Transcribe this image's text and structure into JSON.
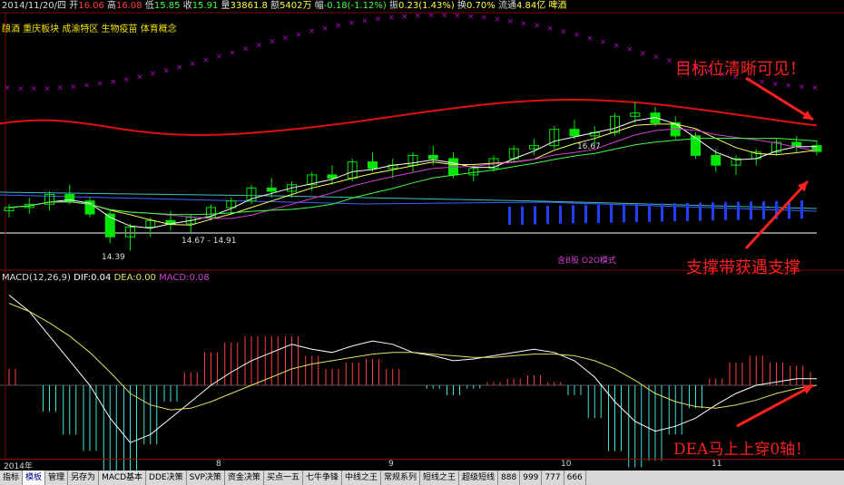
{
  "header": {
    "date": "2014/11/20/四",
    "open_label": "开",
    "open": "16.06",
    "high_label": "高",
    "high": "16.08",
    "low_label": "低",
    "low": "15.85",
    "close_label": "收",
    "close": "15.91",
    "volume_label": "量",
    "volume": "33861.8",
    "amount_label": "额",
    "amount": "5402万",
    "change_label": "幅",
    "change": "-0.18(-1.12%)",
    "amplitude_label": "振",
    "amplitude": "0.23(1.43%)",
    "turnover_label": "换",
    "turnover": "0.70%",
    "float_label": "流通",
    "float_value": "4.84亿",
    "stock_name": "啤酒"
  },
  "concepts": "酿酒 重庆板块 成渝特区 生物疫苗 体育概念",
  "price_labels": {
    "high": "16.67",
    "low": "14.39",
    "mid": "14.67 - 14.91",
    "pattern": "含B股 O2O模式"
  },
  "annotations": {
    "target": "目标位清晰可见！",
    "support": "支撑带获遇支撑",
    "dea": "DEA马上上穿0轴！"
  },
  "macd": {
    "title": "MACD(12,26,9)",
    "dif_label": "DIF:",
    "dif": "0.04",
    "dea_label": "DEA:",
    "dea": "0.00",
    "macd_label": "MACD:",
    "macd": "0.08"
  },
  "dates": [
    "2014年",
    "8",
    "9",
    "10",
    "11"
  ],
  "bottom_tabs": [
    "指标",
    "模板",
    "管理",
    "另存为",
    "MACD基本",
    "DDE决策",
    "SVP决策",
    "资金决策",
    "买点一五",
    "七牛争锋",
    "中线之王",
    "常规系列",
    "短线之王",
    "超级短线",
    "888",
    "999",
    "777",
    "666"
  ],
  "active_tab": "模板",
  "colors": {
    "up": "#00e600",
    "down": "#00e600",
    "red_line": "#e01010",
    "x_marks": "#b000c0",
    "dif": "#ffffff",
    "dea": "#e0e060",
    "macd_pos": "#ff4040",
    "macd_neg": "#40e0e0",
    "annotation": "#ff2020"
  },
  "chart_data": {
    "type": "candlestick",
    "note_series": "price candles trending from ~15 up to 16.67 then consolidating",
    "price_ylim": [
      14.2,
      17.4
    ],
    "candles": [
      [
        15.0,
        15.1,
        14.9,
        15.05
      ],
      [
        15.05,
        15.2,
        14.95,
        15.1
      ],
      [
        15.1,
        15.3,
        15.0,
        15.25
      ],
      [
        15.25,
        15.4,
        15.1,
        15.15
      ],
      [
        15.15,
        15.2,
        14.9,
        14.95
      ],
      [
        14.95,
        15.0,
        14.5,
        14.6
      ],
      [
        14.6,
        14.8,
        14.39,
        14.75
      ],
      [
        14.75,
        14.9,
        14.6,
        14.85
      ],
      [
        14.85,
        15.0,
        14.7,
        14.8
      ],
      [
        14.8,
        14.95,
        14.67,
        14.9
      ],
      [
        14.9,
        15.1,
        14.85,
        15.05
      ],
      [
        15.05,
        15.2,
        14.95,
        15.15
      ],
      [
        15.15,
        15.4,
        15.1,
        15.35
      ],
      [
        15.35,
        15.5,
        15.2,
        15.3
      ],
      [
        15.3,
        15.45,
        15.2,
        15.4
      ],
      [
        15.4,
        15.6,
        15.3,
        15.55
      ],
      [
        15.55,
        15.7,
        15.4,
        15.5
      ],
      [
        15.5,
        15.8,
        15.45,
        15.75
      ],
      [
        15.75,
        15.9,
        15.6,
        15.65
      ],
      [
        15.65,
        15.8,
        15.5,
        15.7
      ],
      [
        15.7,
        15.9,
        15.6,
        15.85
      ],
      [
        15.85,
        16.0,
        15.7,
        15.8
      ],
      [
        15.8,
        15.9,
        15.5,
        15.55
      ],
      [
        15.55,
        15.7,
        15.45,
        15.65
      ],
      [
        15.65,
        15.85,
        15.6,
        15.8
      ],
      [
        15.8,
        16.0,
        15.75,
        15.95
      ],
      [
        15.95,
        16.1,
        15.85,
        16.0
      ],
      [
        16.0,
        16.3,
        15.95,
        16.25
      ],
      [
        16.25,
        16.4,
        16.1,
        16.15
      ],
      [
        16.15,
        16.3,
        16.0,
        16.2
      ],
      [
        16.2,
        16.5,
        16.15,
        16.45
      ],
      [
        16.45,
        16.67,
        16.35,
        16.5
      ],
      [
        16.5,
        16.6,
        16.3,
        16.35
      ],
      [
        16.35,
        16.45,
        16.1,
        16.15
      ],
      [
        16.15,
        16.2,
        15.8,
        15.85
      ],
      [
        15.85,
        15.95,
        15.6,
        15.7
      ],
      [
        15.7,
        15.85,
        15.55,
        15.8
      ],
      [
        15.8,
        15.95,
        15.7,
        15.9
      ],
      [
        15.9,
        16.1,
        15.85,
        16.05
      ],
      [
        16.05,
        16.15,
        15.9,
        16.0
      ],
      [
        16.0,
        16.08,
        15.85,
        15.91
      ]
    ],
    "macd_dif": [
      0.55,
      0.45,
      0.3,
      0.15,
      0.0,
      -0.2,
      -0.35,
      -0.3,
      -0.2,
      -0.1,
      0.0,
      0.08,
      0.15,
      0.2,
      0.25,
      0.22,
      0.2,
      0.24,
      0.27,
      0.25,
      0.2,
      0.18,
      0.15,
      0.16,
      0.18,
      0.2,
      0.22,
      0.2,
      0.15,
      0.05,
      -0.1,
      -0.22,
      -0.28,
      -0.25,
      -0.2,
      -0.12,
      -0.05,
      0.0,
      0.02,
      0.04,
      0.04
    ],
    "macd_dea": [
      0.5,
      0.45,
      0.38,
      0.3,
      0.2,
      0.08,
      -0.05,
      -0.12,
      -0.15,
      -0.14,
      -0.1,
      -0.05,
      0.0,
      0.05,
      0.1,
      0.13,
      0.15,
      0.17,
      0.19,
      0.2,
      0.2,
      0.19,
      0.18,
      0.17,
      0.17,
      0.18,
      0.19,
      0.19,
      0.18,
      0.15,
      0.1,
      0.03,
      -0.05,
      -0.1,
      -0.13,
      -0.14,
      -0.12,
      -0.09,
      -0.05,
      -0.02,
      0.0
    ],
    "macd_ylim": [
      -0.45,
      0.6
    ]
  }
}
